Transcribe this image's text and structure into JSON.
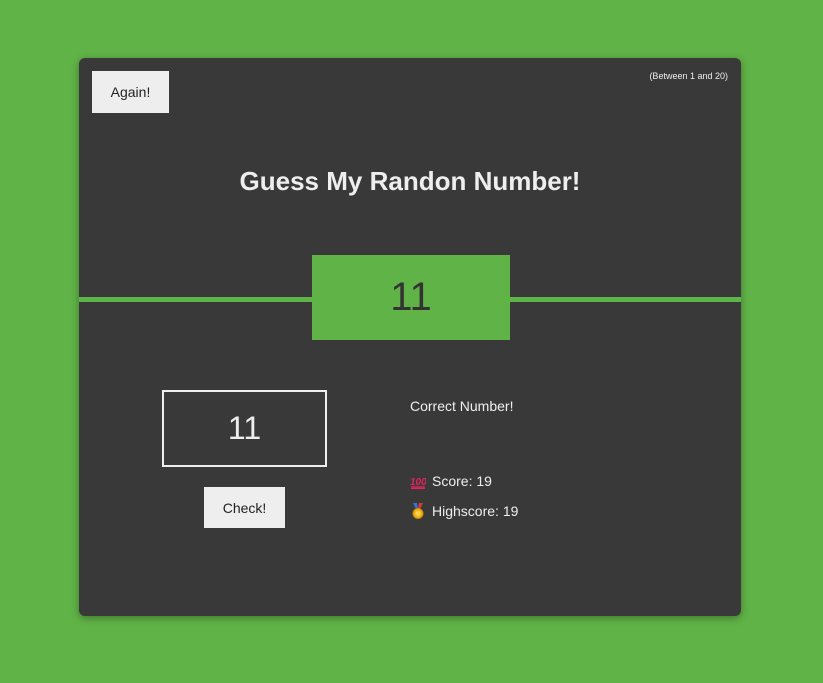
{
  "buttons": {
    "again": "Again!",
    "check": "Check!"
  },
  "hint": "(Between 1 and 20)",
  "title": "Guess My Randon Number!",
  "secret_number": "11",
  "guess": {
    "value": "11"
  },
  "message": "Correct Number!",
  "stats": {
    "score_label": "Score:",
    "score_value": "19",
    "highscore_label": "Highscore:",
    "highscore_value": "19",
    "score_icon": "hundred-points-icon",
    "highscore_icon": "medal-icon"
  },
  "colors": {
    "background": "#60b347",
    "card": "#393939",
    "text": "#eeeeee"
  }
}
